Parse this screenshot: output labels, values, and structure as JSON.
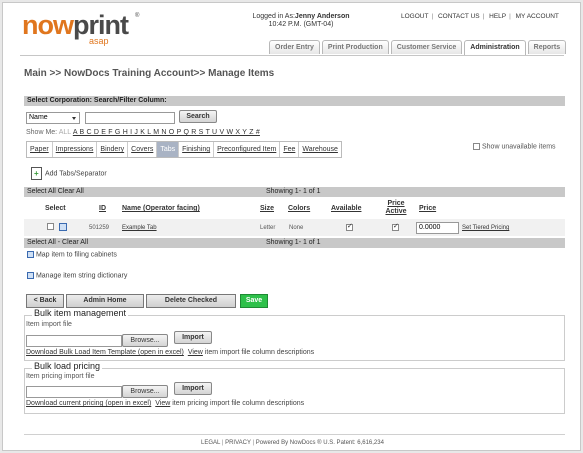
{
  "header": {
    "logo_main_1": "now",
    "logo_main_2": "print",
    "logo_sub": "asap",
    "logo_tm": "®",
    "login_prefix": "Logged in As:",
    "login_user": "Jenny Anderson",
    "login_time": "10:42 P.M. (GMT-04)",
    "toplinks": [
      "LOGOUT",
      "CONTACT US",
      "HELP",
      "MY ACCOUNT"
    ],
    "tabs": [
      "Order Entry",
      "Print Production",
      "Customer Service",
      "Administration",
      "Reports"
    ],
    "active_tab": "Administration"
  },
  "breadcrumb": "Main >> NowDocs Training Account>> Manage Items",
  "filter": {
    "bar_title": "Select Corporation: Search/Filter Column:",
    "column_select": "Name",
    "search_value": "",
    "search_button": "Search",
    "show_me_label": "Show Me:",
    "show_all": "ALL",
    "letters": "A B C D E F G H I J K L M N O P Q R S T U V W X Y Z #"
  },
  "category_tabs": [
    "Paper",
    "Impressions",
    "Bindery",
    "Covers",
    "Tabs",
    "Finishing",
    "Preconfigured Item",
    "Fee",
    "Warehouse"
  ],
  "selected_category": "Tabs",
  "show_unavailable_label": "Show unavailable items",
  "add_tabs_label": "Add Tabs/Separator",
  "grid": {
    "top_bar_left": "Select All Clear All",
    "top_bar_showing": "Showing 1- 1 of 1",
    "bottom_bar_left": "Select All  - Clear All",
    "bottom_bar_showing": "Showing 1- 1 of 1",
    "columns": {
      "select": "Select",
      "id": "ID",
      "name": "Name (Operator facing)",
      "size": "Size",
      "colors": "Colors",
      "available": "Available",
      "price_active": "Price Active",
      "price": "Price"
    },
    "rows": [
      {
        "id": "501259",
        "name": "Example Tab",
        "size": "Letter",
        "colors": "None",
        "available": true,
        "price_active": true,
        "price": "0.0000",
        "tiered_link": "Set Tiered Pricing"
      }
    ]
  },
  "links": {
    "map_filing": "Map item to filing cabinets",
    "manage_dict": "Manage item string dictionary"
  },
  "actions": {
    "back": "< Back",
    "admin_home": "Admin Home",
    "delete_checked": "Delete Checked",
    "save": "Save"
  },
  "bulk_item": {
    "legend": "Bulk item management",
    "file_label": "Item import file",
    "browse": "Browse...",
    "import": "Import",
    "download_link": "Download Bulk Load Item Template (open in excel)",
    "view_link": "View",
    "view_rest": "item import file column descriptions"
  },
  "bulk_pricing": {
    "legend": "Bulk load pricing",
    "file_label": "Item pricing import file",
    "browse": "Browse...",
    "import": "Import",
    "download_link": "Download current pricing (open in excel)",
    "view_link": "View",
    "view_rest": "item pricing import file column descriptions"
  },
  "footer": {
    "legal": "LEGAL",
    "privacy": "PRIVACY",
    "powered": "Powered By NowDocs ® U.S. Patent: 6,616,234"
  },
  "colors": {
    "brand_orange": "#e0761e",
    "save_green": "#2ec04a",
    "bar_gray": "#c8c8c8",
    "selected_tab": "#a9b3c4"
  }
}
